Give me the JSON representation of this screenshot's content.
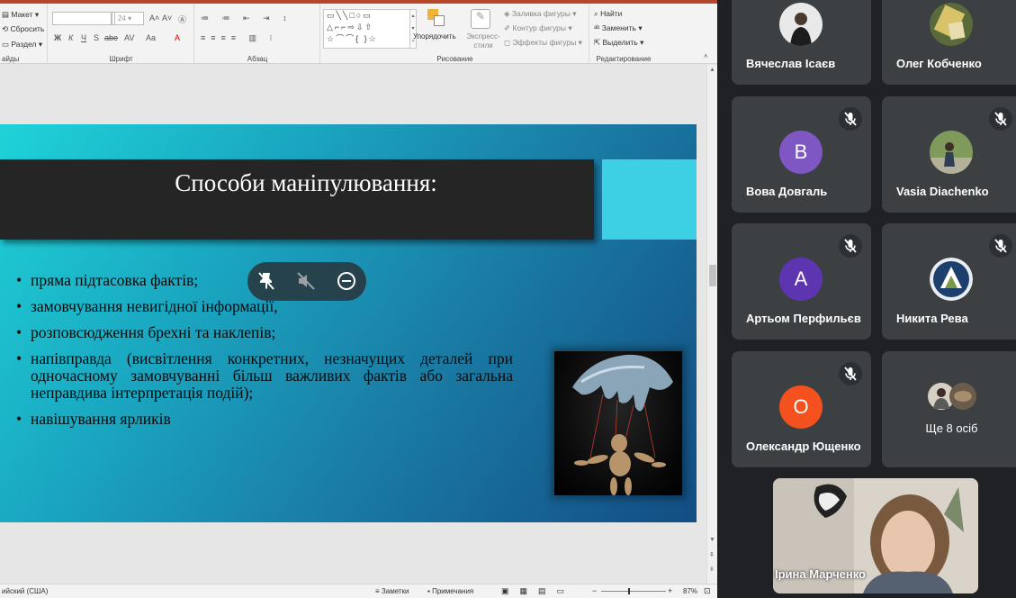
{
  "ribbon": {
    "slides_group": {
      "layout": "Макет",
      "reset": "Сбросить",
      "section": "Раздел",
      "label": "айды"
    },
    "font_group": {
      "font_size": "24",
      "bold": "Ж",
      "italic": "К",
      "underline": "Ч",
      "strike": "S",
      "strike2": "abe",
      "spacing": "AV",
      "case": "Aa",
      "grow": "A",
      "shrink": "A",
      "label": "Шрифт"
    },
    "paragraph_group": {
      "label": "Абзац"
    },
    "drawing_group": {
      "arrange": "Упорядочить",
      "quick_styles": "Экспресс-стили",
      "fill": "Заливка фигуры",
      "outline": "Контур фигуры",
      "effects": "Эффекты фигуры",
      "label": "Рисование"
    },
    "editing_group": {
      "find": "Найти",
      "replace": "Заменить",
      "select": "Выделить",
      "label": "Редактирование"
    }
  },
  "slide": {
    "title": "Способи  маніпулювання:",
    "bullets": [
      "пряма підтасовка фактів;",
      " замовчування невигідної інформації,",
      "розповсюдження брехні та наклепів;",
      "напівправда (висвітлення конкретних, незначущих деталей при одночасному замовчуванні більш важливих фактів або загальна неправдива інтерпретація подій);",
      "навішування ярликів"
    ]
  },
  "statusbar": {
    "language": "ийский (США)",
    "notes": "Заметки",
    "comments": "Примечания",
    "zoom": "87%"
  },
  "participants": [
    {
      "name": "Вячеслав Ісаєв",
      "avatar": "photo",
      "muted": false
    },
    {
      "name": "Олег Кобченко",
      "avatar": "photo",
      "muted": false
    },
    {
      "name": "Вова Довгаль",
      "avatar": "В",
      "color": "#7e57c2",
      "muted": true
    },
    {
      "name": "Vasia Diachenko",
      "avatar": "photo",
      "muted": true
    },
    {
      "name": "Артьом Перфильєв",
      "avatar": "А",
      "color": "#5e35b1",
      "muted": true
    },
    {
      "name": "Никита Рева",
      "avatar": "photo",
      "muted": true
    },
    {
      "name": "Олександр Ющенко",
      "avatar": "О",
      "color": "#f4511e",
      "muted": true
    }
  ],
  "more_participants": "Ще 8 осіб",
  "self_view": {
    "name": "Ірина Марченко"
  }
}
